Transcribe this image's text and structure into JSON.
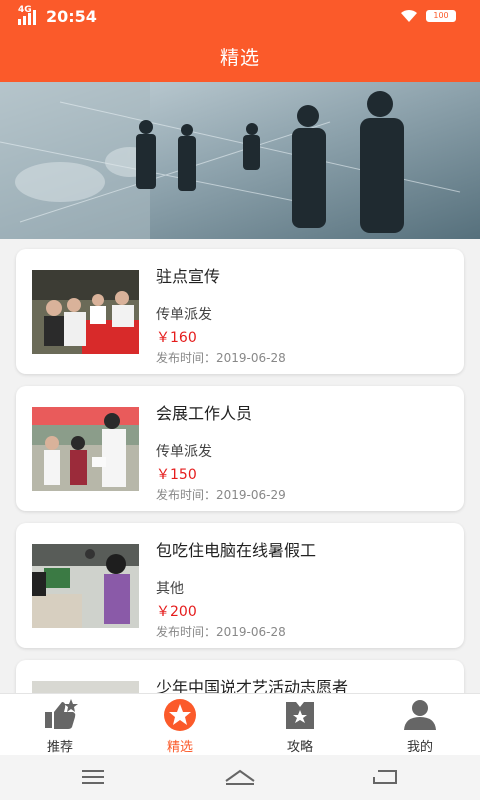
{
  "status": {
    "network": "4G",
    "time": "20:54",
    "battery": "100"
  },
  "header": {
    "title": "精选"
  },
  "banner": {
    "slides": 2,
    "active_index": 0
  },
  "jobs": [
    {
      "title": "驻点宣传",
      "category": "传单派发",
      "price": "￥160",
      "date": "发布时间：2019-06-28"
    },
    {
      "title": "会展工作人员",
      "category": "传单派发",
      "price": "￥150",
      "date": "发布时间：2019-06-29"
    },
    {
      "title": "包吃住电脑在线暑假工",
      "category": "其他",
      "price": "￥200",
      "date": "发布时间：2019-06-28"
    },
    {
      "title": "少年中国说才艺活动志愿者"
    }
  ],
  "tabs": [
    {
      "label": "推荐",
      "icon": "thumbs-up-icon"
    },
    {
      "label": "精选",
      "icon": "star-icon",
      "active": true
    },
    {
      "label": "攻略",
      "icon": "bookmark-star-icon"
    },
    {
      "label": "我的",
      "icon": "user-icon"
    }
  ],
  "colors": {
    "accent": "#fb5a2a",
    "price": "#e51c1c"
  }
}
